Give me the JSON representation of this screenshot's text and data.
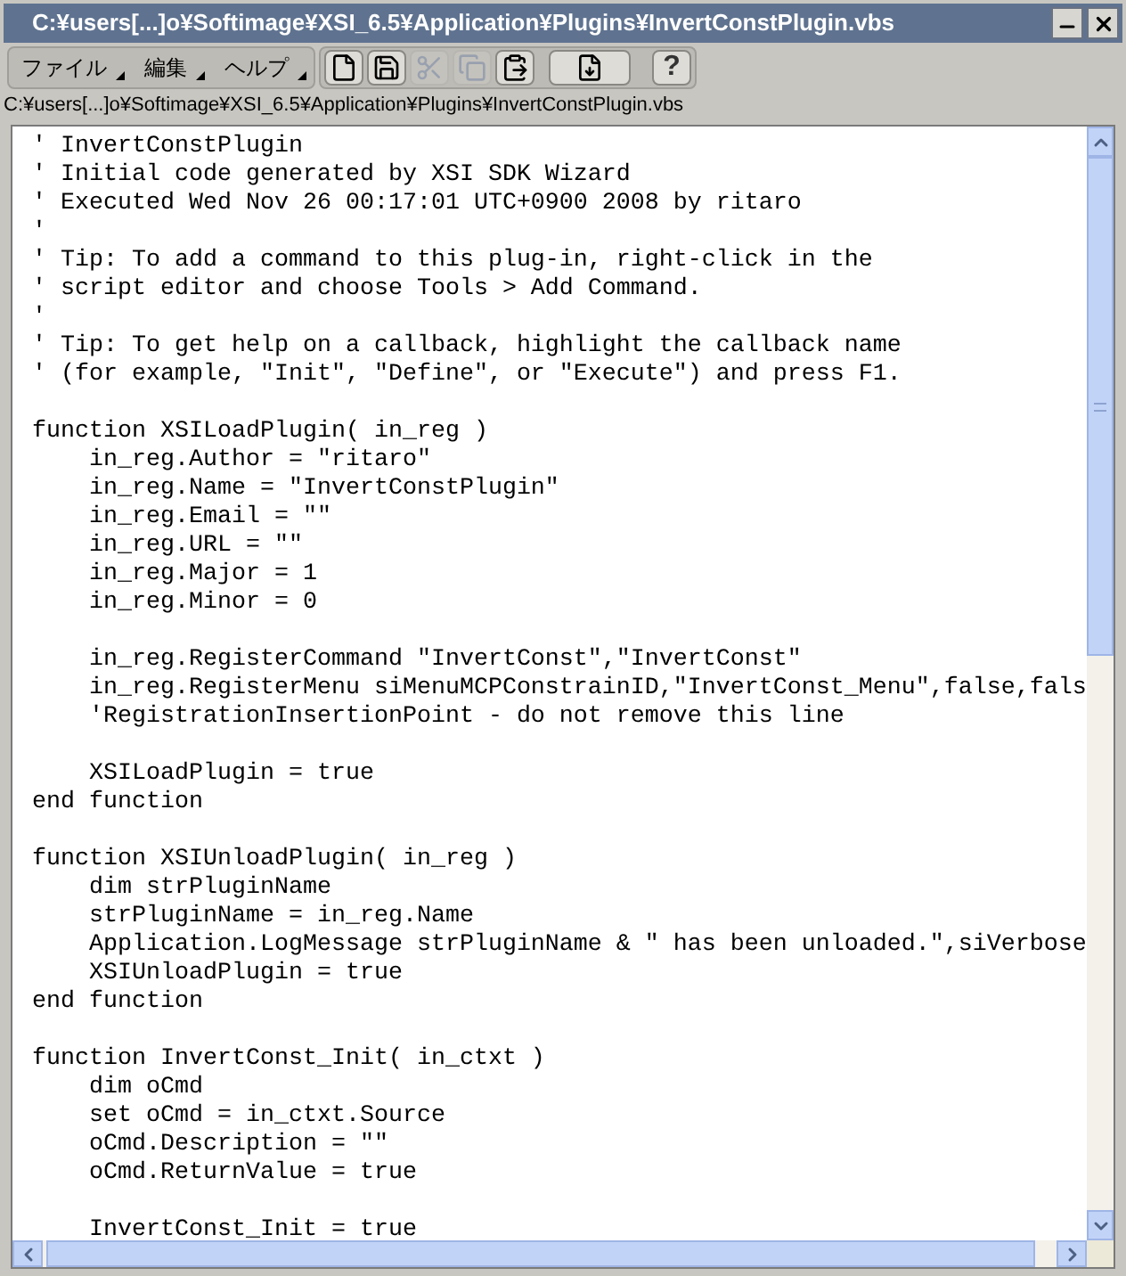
{
  "window": {
    "title": "C:¥users[...]o¥Softimage¥XSI_6.5¥Application¥Plugins¥InvertConstPlugin.vbs"
  },
  "menus": [
    {
      "label": "ファイル"
    },
    {
      "label": "編集"
    },
    {
      "label": "ヘルプ"
    }
  ],
  "toolbar": [
    {
      "kind": "new",
      "disabled": false
    },
    {
      "kind": "save",
      "disabled": false
    },
    {
      "kind": "cut",
      "disabled": true
    },
    {
      "kind": "copy",
      "disabled": true
    },
    {
      "kind": "paste",
      "disabled": false
    },
    {
      "kind": "insert",
      "disabled": false
    },
    {
      "kind": "help",
      "label": "?",
      "disabled": false
    }
  ],
  "path": "C:¥users[...]o¥Softimage¥XSI_6.5¥Application¥Plugins¥InvertConstPlugin.vbs",
  "editor": {
    "blocks": [
      [
        "' InvertConstPlugin",
        "' Initial code generated by XSI SDK Wizard",
        "' Executed Wed Nov 26 00:17:01 UTC+0900 2008 by ritaro",
        "'",
        "' Tip: To add a command to this plug-in, right-click in the",
        "' script editor and choose Tools > Add Command.",
        "'",
        "' Tip: To get help on a callback, highlight the callback name",
        "' (for example, \"Init\", \"Define\", or \"Execute\") and press F1."
      ],
      [
        "function XSILoadPlugin( in_reg )",
        "    in_reg.Author = \"ritaro\"",
        "    in_reg.Name = \"InvertConstPlugin\"",
        "    in_reg.Email = \"\"",
        "    in_reg.URL = \"\"",
        "    in_reg.Major = 1",
        "    in_reg.Minor = 0"
      ],
      [
        "    in_reg.RegisterCommand \"InvertConst\",\"InvertConst\"",
        "    in_reg.RegisterMenu siMenuMCPConstrainID,\"InvertConst_Menu\",false,fals",
        "    'RegistrationInsertionPoint - do not remove this line"
      ],
      [
        "    XSILoadPlugin = true",
        "end function"
      ],
      [
        "function XSIUnloadPlugin( in_reg )",
        "    dim strPluginName",
        "    strPluginName = in_reg.Name",
        "    Application.LogMessage strPluginName & \" has been unloaded.\",siVerbose",
        "    XSIUnloadPlugin = true",
        "end function"
      ],
      [
        "function InvertConst_Init( in_ctxt )",
        "    dim oCmd",
        "    set oCmd = in_ctxt.Source",
        "    oCmd.Description = \"\"",
        "    oCmd.ReturnValue = true"
      ],
      [
        "    InvertConst_Init = true"
      ]
    ]
  }
}
